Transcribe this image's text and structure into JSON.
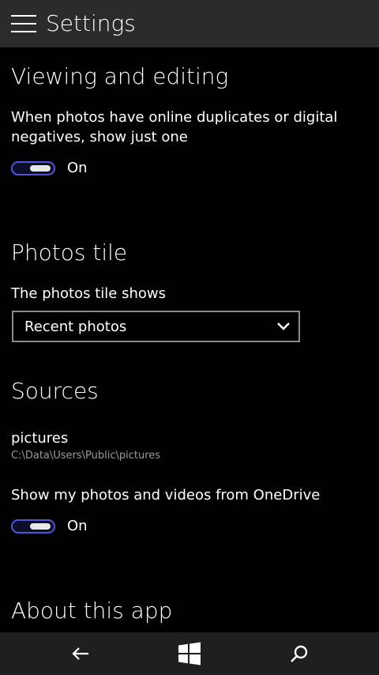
{
  "header": {
    "title": "Settings",
    "menu_icon": "hamburger-menu-icon"
  },
  "viewing": {
    "heading": "Viewing and editing",
    "description_line1": "When photos have online duplicates or digital",
    "description_line2": "negatives, show just one",
    "toggle_state": "On",
    "toggle_on": true
  },
  "tile": {
    "heading": "Photos tile",
    "label": "The photos tile shows",
    "selected": "Recent photos"
  },
  "sources": {
    "heading": "Sources",
    "folder_name": "pictures",
    "folder_path": "C:\\Data\\Users\\Public\\pictures",
    "onedrive_label": "Show my photos and videos from OneDrive",
    "toggle_state": "On",
    "toggle_on": true
  },
  "about": {
    "heading": "About this app"
  },
  "navbar": {
    "back_icon": "back-arrow-icon",
    "home_icon": "windows-logo-icon",
    "search_icon": "search-icon"
  },
  "colors": {
    "accent": "#4a58d4",
    "topbar": "#2b2b2b",
    "navbar": "#1f1f1f",
    "background": "#000000",
    "secondary_text": "#9a9a9a"
  }
}
